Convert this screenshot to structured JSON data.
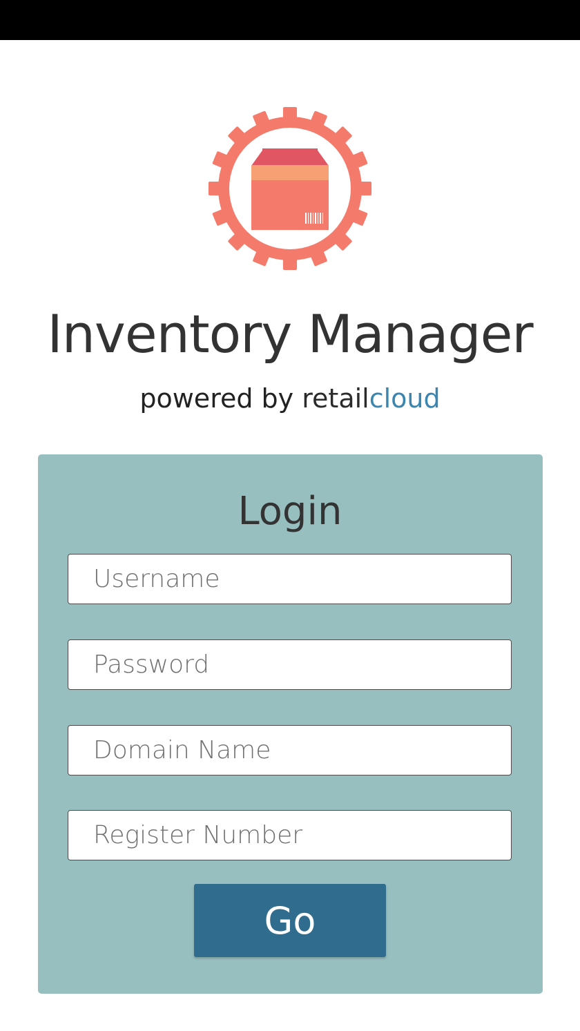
{
  "app": {
    "title": "Inventory Manager",
    "powered_by": "powered by",
    "brand_part1": "retail",
    "brand_part2": "cloud"
  },
  "login": {
    "heading": "Login",
    "username_placeholder": "Username",
    "password_placeholder": "Password",
    "domain_placeholder": "Domain Name",
    "register_placeholder": "Register Number",
    "submit_label": "Go"
  },
  "colors": {
    "status_bar": "#000000",
    "logo_coral": "#f47b6b",
    "logo_box_top": "#e05763",
    "card_background": "#98bfc0",
    "button_background": "#2f6c8d",
    "brand_cloud": "#3a86b0"
  },
  "icons": {
    "logo": "gear-with-box-icon"
  }
}
